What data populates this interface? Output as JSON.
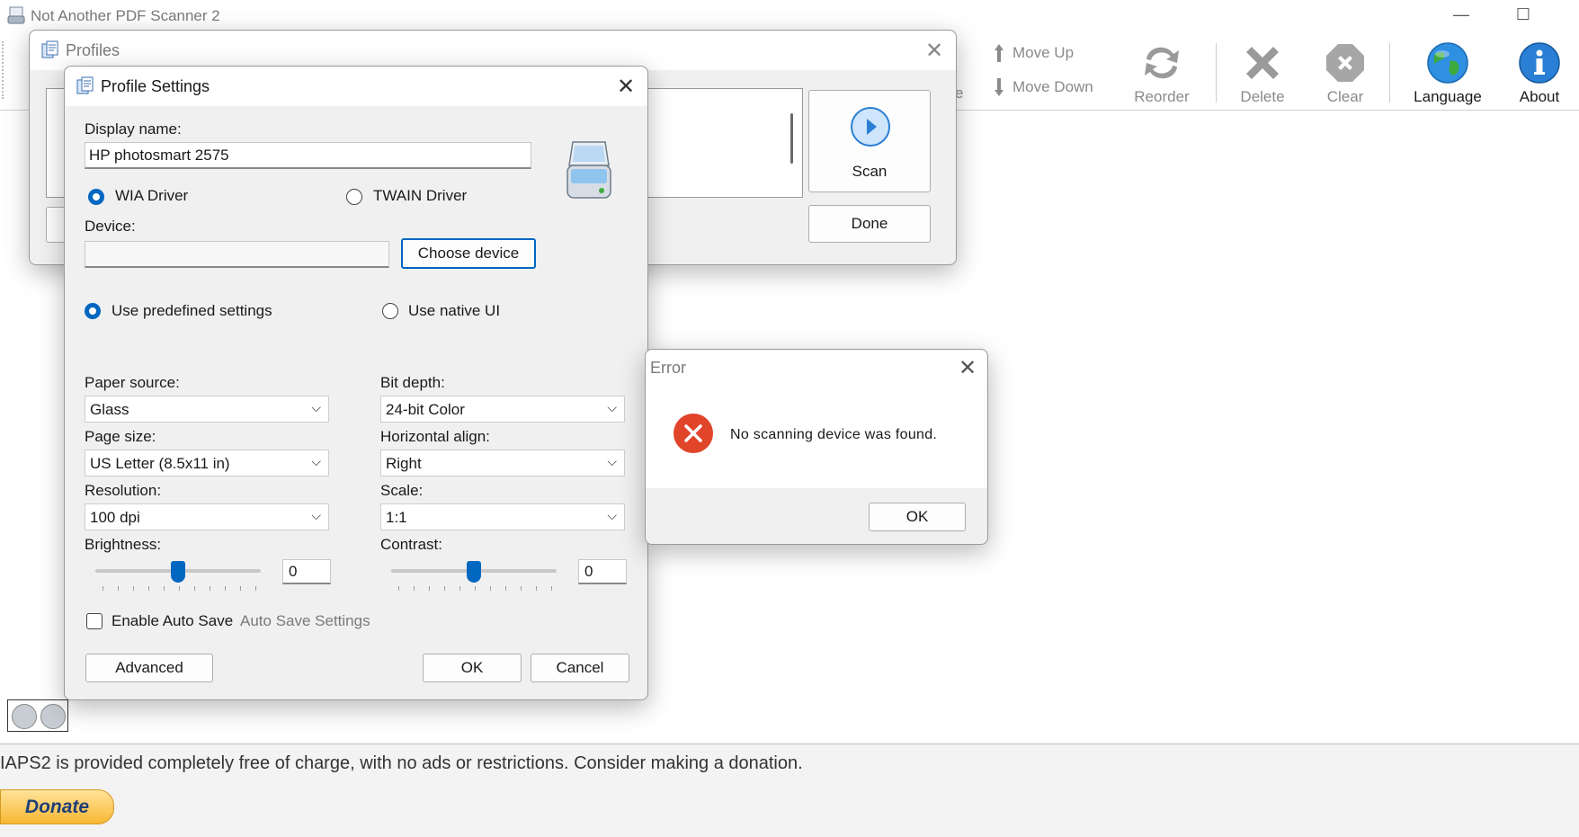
{
  "app": {
    "title": "Not Another PDF Scanner 2",
    "minimize_glyph": "—",
    "maximize_glyph": "☐"
  },
  "toolbar": {
    "move_up": "Move Up",
    "move_down": "Move Down",
    "reorder": "Reorder",
    "delete": "Delete",
    "clear": "Clear",
    "language": "Language",
    "about": "About",
    "partial_label": "e"
  },
  "footer": {
    "donate_message": "IAPS2 is provided completely free of charge, with no ads or restrictions. Consider making a donation.",
    "donate_button": "Donate"
  },
  "profiles_dialog": {
    "title": "Profiles",
    "scan_button": "Scan",
    "done_button": "Done"
  },
  "profile_settings": {
    "title": "Profile Settings",
    "display_name_label": "Display name:",
    "display_name_value": "HP photosmart 2575",
    "wia_driver": "WIA Driver",
    "twain_driver": "TWAIN Driver",
    "selected_driver": "WIA Driver",
    "device_label": "Device:",
    "device_value": "",
    "choose_device": "Choose device",
    "use_predefined": "Use predefined settings",
    "use_native_ui": "Use native UI",
    "selected_mode": "Use predefined settings",
    "paper_source_label": "Paper source:",
    "paper_source_value": "Glass",
    "page_size_label": "Page size:",
    "page_size_value": "US Letter (8.5x11 in)",
    "resolution_label": "Resolution:",
    "resolution_value": "100 dpi",
    "brightness_label": "Brightness:",
    "brightness_value": "0",
    "bit_depth_label": "Bit depth:",
    "bit_depth_value": "24-bit Color",
    "horizontal_align_label": "Horizontal align:",
    "horizontal_align_value": "Right",
    "scale_label": "Scale:",
    "scale_value": "1:1",
    "contrast_label": "Contrast:",
    "contrast_value": "0",
    "enable_auto_save": "Enable Auto Save",
    "auto_save_checked": false,
    "auto_save_settings": "Auto Save Settings",
    "advanced": "Advanced",
    "ok": "OK",
    "cancel": "Cancel"
  },
  "error_dialog": {
    "title": "Error",
    "message": "No scanning device was found.",
    "ok": "OK"
  },
  "colors": {
    "accent": "#0067c0",
    "error_red": "#e0452a",
    "disabled_gray": "#8a8a8a",
    "globe_blue": "#2f8fe0",
    "globe_green": "#3daa3d"
  }
}
